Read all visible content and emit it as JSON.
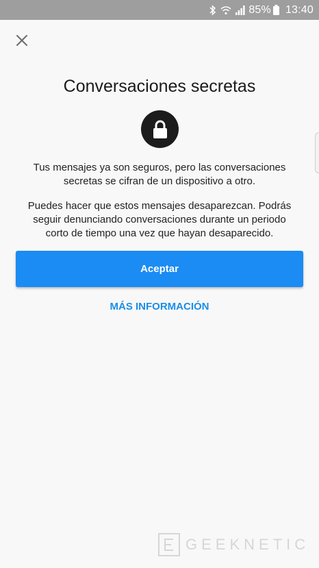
{
  "status_bar": {
    "battery_percent": "85%",
    "time": "13:40",
    "icons": [
      "bluetooth-icon",
      "wifi-icon",
      "signal-icon",
      "battery-icon"
    ]
  },
  "dialog": {
    "close_icon": "close-icon",
    "title": "Conversaciones secretas",
    "lock_icon": "lock-icon",
    "paragraph1_line1": "Tus mensajes ya son seguros, pero las conversaciones",
    "paragraph1_line2": "secretas se cifran de un dispositivo a otro.",
    "paragraph2_line1": "Puedes hacer que estos mensajes desaparezcan. Podrás",
    "paragraph2_line2": "seguir denunciando conversaciones durante un periodo",
    "paragraph2_line3": "corto de tiempo una vez que hayan desaparecido.",
    "accept_label": "Aceptar",
    "more_info_label": "MÁS INFORMACIÓN"
  },
  "watermark": {
    "text": "GEEKNETIC"
  },
  "colors": {
    "accent": "#1b8cf3",
    "link": "#1a8ee8",
    "status_bar": "#9e9e9e",
    "background": "#f8f8f8"
  }
}
